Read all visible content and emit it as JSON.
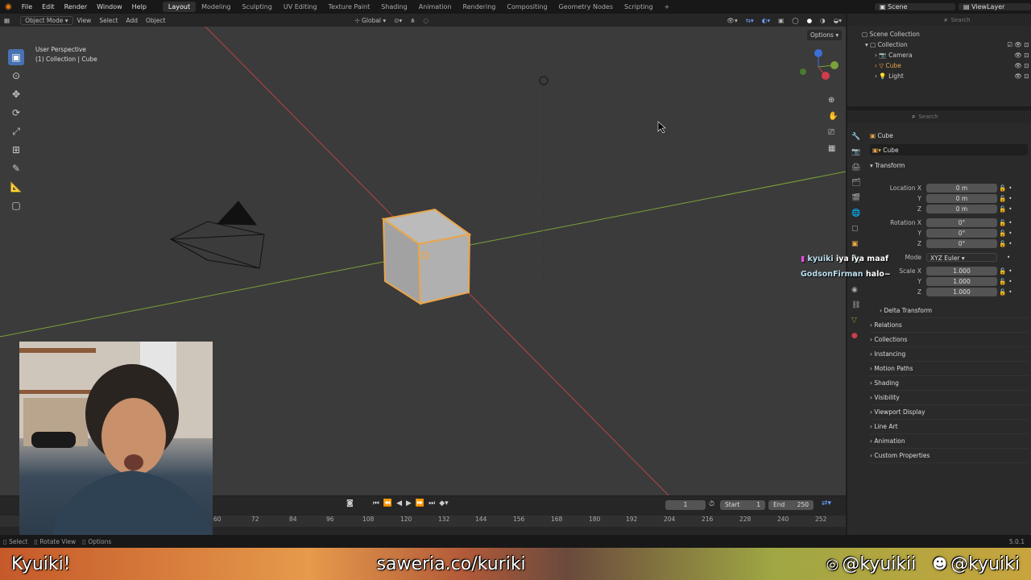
{
  "topbar": {
    "menus": [
      "File",
      "Edit",
      "Render",
      "Window",
      "Help"
    ],
    "workspaces": [
      "Layout",
      "Modeling",
      "Sculpting",
      "UV Editing",
      "Texture Paint",
      "Shading",
      "Animation",
      "Rendering",
      "Compositing",
      "Geometry Nodes",
      "Scripting"
    ],
    "active_workspace": "Layout",
    "add_tab": "+",
    "scene": "Scene",
    "viewlayer": "ViewLayer"
  },
  "viewport_header": {
    "mode": "Object Mode",
    "menus": [
      "View",
      "Select",
      "Add",
      "Object"
    ],
    "transform": "Global",
    "options": "Options"
  },
  "viewport": {
    "perspective": "User Perspective",
    "collection_info": "(1) Collection | Cube"
  },
  "outliner": {
    "search_placeholder": "Search",
    "root": "Scene Collection",
    "collection": "Collection",
    "items": [
      "Camera",
      "Cube",
      "Light"
    ]
  },
  "properties": {
    "search_placeholder": "Search",
    "object_name": "Cube",
    "data_name": "Cube",
    "transform_label": "Transform",
    "location_labels": [
      "Location X",
      "Y",
      "Z"
    ],
    "location_values": [
      "0 m",
      "0 m",
      "0 m"
    ],
    "rotation_labels": [
      "Rotation X",
      "Y",
      "Z"
    ],
    "rotation_values": [
      "0°",
      "0°",
      "0°"
    ],
    "mode_label": "Mode",
    "mode_value": "XYZ Euler",
    "scale_labels": [
      "Scale X",
      "Y",
      "Z"
    ],
    "scale_values": [
      "1.000",
      "1.000",
      "1.000"
    ],
    "delta": "Delta Transform",
    "panels": [
      "Relations",
      "Collections",
      "Instancing",
      "Motion Paths",
      "Shading",
      "Visibility",
      "Viewport Display",
      "Line Art",
      "Animation",
      "Custom Properties"
    ]
  },
  "timeline": {
    "current_frame": "1",
    "start_label": "Start",
    "start": "1",
    "end_label": "End",
    "end": "250",
    "ticks": [
      "60",
      "72",
      "84",
      "96",
      "108",
      "120",
      "132",
      "144",
      "156",
      "168",
      "180",
      "192",
      "204",
      "216",
      "228",
      "240",
      "252"
    ]
  },
  "statusbar": {
    "select": "Select",
    "rotate": "Rotate View",
    "options": "Options",
    "version": "5.0.1"
  },
  "chat": [
    {
      "user": "kyuiki",
      "msg": "iya iya maaf"
    },
    {
      "user": "GodsonFirman",
      "msg": "halo~"
    }
  ],
  "banner": {
    "left": "Kyuiki!",
    "center": "saweria.co/kuriki",
    "instagram": "@kyuikii",
    "discord": "@kyuiki"
  },
  "colors": {
    "accent": "#4772b3",
    "selection": "#e8a64a",
    "x_axis": "#b84444",
    "y_axis": "#7aa238",
    "viewport_bg": "#3b3b3b"
  }
}
